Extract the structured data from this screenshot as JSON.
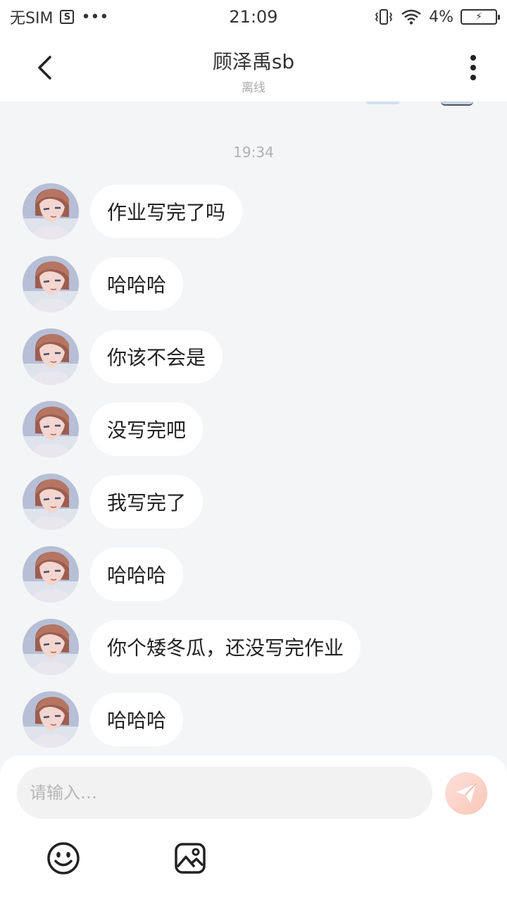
{
  "status_bar": {
    "carrier": "无SIM",
    "sim_badge": "S",
    "dots": "•••",
    "time": "21:09",
    "battery_percent": "4%"
  },
  "header": {
    "title": "顾泽禹sb",
    "subtitle": "离线",
    "back_icon": "chevron-left-icon",
    "more_icon": "more-vertical-icon"
  },
  "chat": {
    "timestamp": "19:34",
    "messages": [
      {
        "text": "作业写完了吗"
      },
      {
        "text": "哈哈哈"
      },
      {
        "text": "你该不会是"
      },
      {
        "text": "没写完吧"
      },
      {
        "text": "我写完了"
      },
      {
        "text": "哈哈哈"
      },
      {
        "text": "你个矮冬瓜，还没写完作业"
      },
      {
        "text": "哈哈哈"
      }
    ]
  },
  "input": {
    "placeholder": "请输入…",
    "value": ""
  },
  "toolbar": {
    "emoji_icon": "emoji-icon",
    "image_icon": "image-icon",
    "send_icon": "send-icon"
  },
  "colors": {
    "background": "#f4f5f7",
    "send_button": "#f9c7b6",
    "bubble": "#ffffff"
  }
}
